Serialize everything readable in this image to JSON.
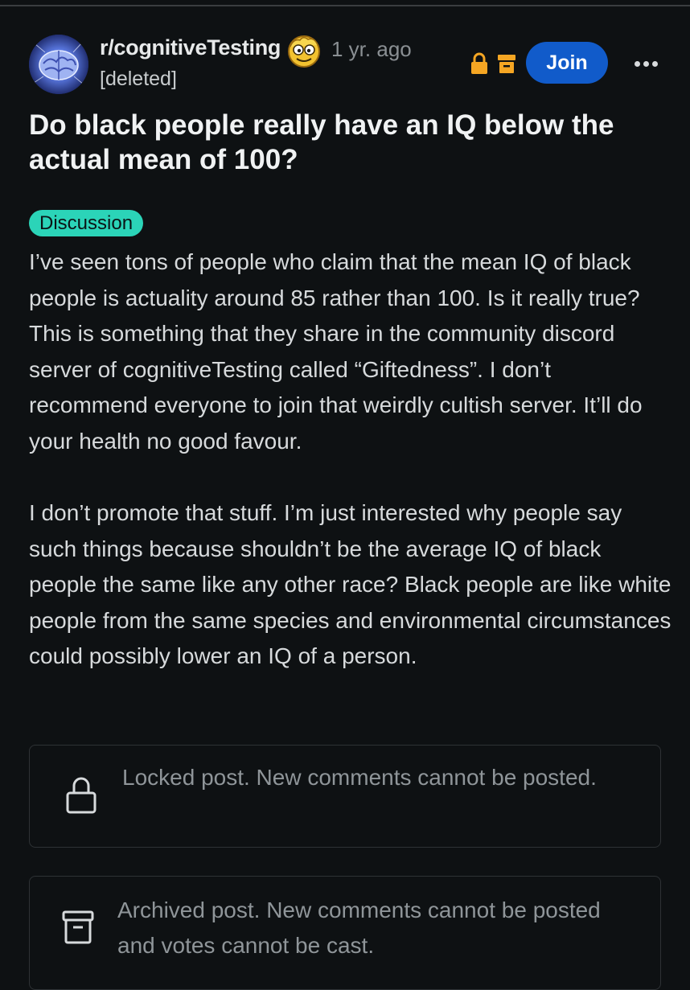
{
  "header": {
    "subreddit": "r/cognitiveTesting",
    "time_ago": "1 yr. ago",
    "author": "[deleted]",
    "join_label": "Join",
    "icons": [
      "subreddit-avatar-icon",
      "flair-emoji-icon",
      "lock-icon",
      "archive-icon",
      "more-options-icon"
    ]
  },
  "post": {
    "title": "Do black people really have an IQ below the actual mean of 100?",
    "flair": "Discussion",
    "paragraphs": [
      "I’ve seen tons of people who claim that the mean IQ of black people is actuality around 85 rather than 100. Is it really true? This is something that they share in the community discord server of cognitiveTesting called “Giftedness”. I don’t recommend everyone to join that weirdly cultish server. It’ll do your health no good favour.",
      "I don’t promote that stuff. I’m just interested why people say such things because shouldn’t be the average IQ of black people the same like any other race? Black people are like white people from the same species and environmental circumstances could possibly lower an IQ of a person."
    ]
  },
  "notices": {
    "locked": "Locked post. New comments cannot be posted.",
    "archived": "Archived post. New comments cannot be posted and votes cannot be cast."
  },
  "colors": {
    "background": "#0e1113",
    "join_button": "#115bca",
    "flair": "#2bd4b8",
    "status_icons": "#f5a623"
  }
}
